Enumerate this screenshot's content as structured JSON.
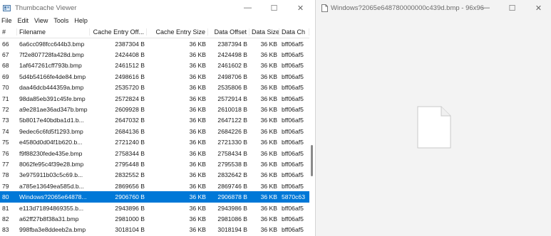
{
  "left_window": {
    "title": "Thumbcache Viewer",
    "controls": {
      "minimize": "—",
      "maximize": "☐",
      "close": "✕"
    },
    "menu": [
      "File",
      "Edit",
      "View",
      "Tools",
      "Help"
    ],
    "columns": [
      "#",
      "Filename",
      "Cache Entry Off...",
      "Cache Entry Size",
      "Data Offset",
      "Data Size",
      "Data Ch"
    ],
    "rows": [
      {
        "idx": "66",
        "file": "6a6cc098fcc644b3.bmp",
        "off": "2387304 B",
        "size": "36 KB",
        "doff": "2387394 B",
        "dsize": "36 KB",
        "dchk": "bff06af5"
      },
      {
        "idx": "67",
        "file": "7f2e807728fa428d.bmp",
        "off": "2424408 B",
        "size": "36 KB",
        "doff": "2424498 B",
        "dsize": "36 KB",
        "dchk": "bff06af5"
      },
      {
        "idx": "68",
        "file": "1af647261cff793b.bmp",
        "off": "2461512 B",
        "size": "36 KB",
        "doff": "2461602 B",
        "dsize": "36 KB",
        "dchk": "bff06af5"
      },
      {
        "idx": "69",
        "file": "5d4b54166fe4de84.bmp",
        "off": "2498616 B",
        "size": "36 KB",
        "doff": "2498706 B",
        "dsize": "36 KB",
        "dchk": "bff06af5"
      },
      {
        "idx": "70",
        "file": "daa46dcb444359a.bmp",
        "off": "2535720 B",
        "size": "36 KB",
        "doff": "2535806 B",
        "dsize": "36 KB",
        "dchk": "bff06af5"
      },
      {
        "idx": "71",
        "file": "98da85eb391c45fe.bmp",
        "off": "2572824 B",
        "size": "36 KB",
        "doff": "2572914 B",
        "dsize": "36 KB",
        "dchk": "bff06af5"
      },
      {
        "idx": "72",
        "file": "a9e281ae36ad347b.bmp",
        "off": "2609928 B",
        "size": "36 KB",
        "doff": "2610018 B",
        "dsize": "36 KB",
        "dchk": "bff06af5"
      },
      {
        "idx": "73",
        "file": "5b8017e40bdba1d1.b...",
        "off": "2647032 B",
        "size": "36 KB",
        "doff": "2647122 B",
        "dsize": "36 KB",
        "dchk": "bff06af5"
      },
      {
        "idx": "74",
        "file": "9edec6c6fd5f1293.bmp",
        "off": "2684136 B",
        "size": "36 KB",
        "doff": "2684226 B",
        "dsize": "36 KB",
        "dchk": "bff06af5"
      },
      {
        "idx": "75",
        "file": "e4580d0d04f1b620.b...",
        "off": "2721240 B",
        "size": "36 KB",
        "doff": "2721330 B",
        "dsize": "36 KB",
        "dchk": "bff06af5"
      },
      {
        "idx": "76",
        "file": "f9f88230fede435e.bmp",
        "off": "2758344 B",
        "size": "36 KB",
        "doff": "2758434 B",
        "dsize": "36 KB",
        "dchk": "bff06af5"
      },
      {
        "idx": "77",
        "file": "8062fe95c4f39e28.bmp",
        "off": "2795448 B",
        "size": "36 KB",
        "doff": "2795538 B",
        "dsize": "36 KB",
        "dchk": "bff06af5"
      },
      {
        "idx": "78",
        "file": "3e975911b03c5c69.b...",
        "off": "2832552 B",
        "size": "36 KB",
        "doff": "2832642 B",
        "dsize": "36 KB",
        "dchk": "bff06af5"
      },
      {
        "idx": "79",
        "file": "a785e13649ea585d.b...",
        "off": "2869656 B",
        "size": "36 KB",
        "doff": "2869746 B",
        "dsize": "36 KB",
        "dchk": "bff06af5"
      },
      {
        "idx": "80",
        "file": "Windows?2065e64878...",
        "off": "2906760 B",
        "size": "36 KB",
        "doff": "2906878 B",
        "dsize": "36 KB",
        "dchk": "5870c63"
      },
      {
        "idx": "81",
        "file": "e113d71894869355.b...",
        "off": "2943896 B",
        "size": "36 KB",
        "doff": "2943986 B",
        "dsize": "36 KB",
        "dchk": "bff06af5"
      },
      {
        "idx": "82",
        "file": "a62ff27b8f38a31.bmp",
        "off": "2981000 B",
        "size": "36 KB",
        "doff": "2981086 B",
        "dsize": "36 KB",
        "dchk": "bff06af5"
      },
      {
        "idx": "83",
        "file": "998fba3e8ddeeb2a.bmp",
        "off": "3018104 B",
        "size": "36 KB",
        "doff": "3018194 B",
        "dsize": "36 KB",
        "dchk": "bff06af5"
      },
      {
        "idx": "84",
        "file": "37517d17e15f8bc.bmp",
        "off": "3055208 B",
        "size": "36 KB",
        "doff": "3055294 B",
        "dsize": "36 KB",
        "dchk": "bff06af5"
      }
    ],
    "selected_row": "80"
  },
  "right_window": {
    "title": "Windows?2065e648780000000c439d.bmp - 96x96",
    "controls": {
      "minimize": "—",
      "maximize": "☐",
      "close": "✕"
    },
    "preview_icon": "blank-document-icon"
  }
}
